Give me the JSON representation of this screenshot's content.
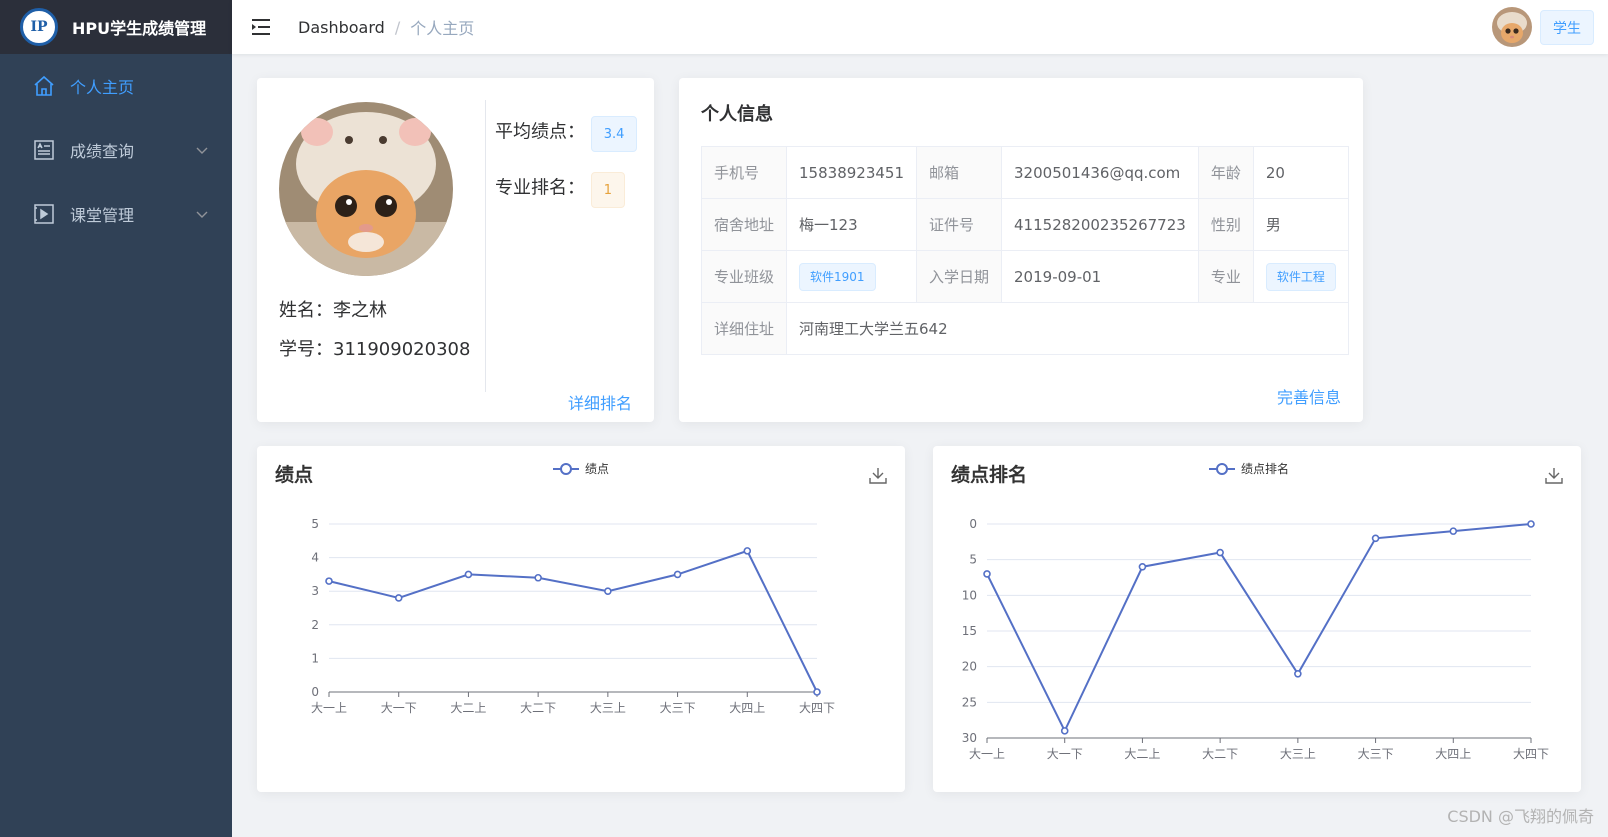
{
  "app": {
    "title": "HPU学生成绩管理",
    "logo_text": "IP"
  },
  "sidebar": {
    "items": [
      {
        "label": "个人主页",
        "icon": "home-icon"
      },
      {
        "label": "成绩查询",
        "icon": "document-icon"
      },
      {
        "label": "课堂管理",
        "icon": "video-icon"
      }
    ]
  },
  "header": {
    "breadcrumb": [
      "Dashboard",
      "个人主页"
    ],
    "role": "学生"
  },
  "profile": {
    "name_label": "姓名：",
    "name": "李之林",
    "id_label": "学号：",
    "student_id": "311909020308",
    "gpa_label": "平均绩点：",
    "gpa": "3.4",
    "rank_label": "专业排名：",
    "rank": "1",
    "detail_link": "详细排名"
  },
  "info": {
    "title": "个人信息",
    "phone_label": "手机号",
    "phone": "15838923451",
    "email_label": "邮箱",
    "email": "3200501436@qq.com",
    "age_label": "年龄",
    "age": "20",
    "dorm_label": "宿舍地址",
    "dorm": "梅一123",
    "idcard_label": "证件号",
    "idcard": "411528200235267723",
    "gender_label": "性别",
    "gender": "男",
    "class_label": "专业班级",
    "class": "软件1901",
    "enroll_label": "入学日期",
    "enroll": "2019-09-01",
    "major_label": "专业",
    "major": "软件工程",
    "address_label": "详细住址",
    "address": "河南理工大学兰五642",
    "complete_link": "完善信息"
  },
  "colors": {
    "accent": "#409eff",
    "line": "#5470c6",
    "sidebar": "#304156"
  },
  "chart_data": [
    {
      "type": "line",
      "title": "绩点",
      "categories": [
        "大一上",
        "大一下",
        "大二上",
        "大二下",
        "大三上",
        "大三下",
        "大四上",
        "大四下"
      ],
      "series": [
        {
          "name": "绩点",
          "values": [
            3.3,
            2.8,
            3.5,
            3.4,
            3.0,
            3.5,
            4.2,
            0
          ]
        }
      ],
      "yticks": [
        "0",
        "1",
        "2",
        "3",
        "4",
        "5"
      ],
      "ylim": [
        0,
        5
      ],
      "inverse": false
    },
    {
      "type": "line",
      "title": "绩点排名",
      "categories": [
        "大一上",
        "大一下",
        "大二上",
        "大二下",
        "大三上",
        "大三下",
        "大四上",
        "大四下"
      ],
      "series": [
        {
          "name": "绩点排名",
          "values": [
            7,
            29,
            6,
            4,
            21,
            2,
            1,
            0
          ]
        }
      ],
      "yticks": [
        "0",
        "5",
        "10",
        "15",
        "20",
        "25",
        "30"
      ],
      "ylim": [
        0,
        30
      ],
      "inverse": true
    }
  ],
  "watermark": "CSDN @飞翔的佩奇"
}
